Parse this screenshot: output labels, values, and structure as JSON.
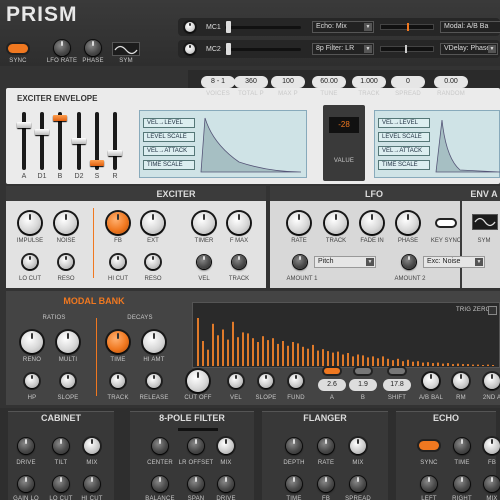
{
  "app": {
    "title": "PRISM"
  },
  "header": {
    "sync": "SYNC",
    "lfo_rate": "LFO RATE",
    "phase": "PHASE",
    "sym": "SYM",
    "mc1": "MC1",
    "mc2": "MC2",
    "sel1": "Echo: Mix",
    "sel2": "Modal: A/B Ba",
    "sel3": "8p Filter: LR",
    "sel4": "VDelay: Phase"
  },
  "params": [
    {
      "value": "8 - 1",
      "label": "VOICES"
    },
    {
      "value": "360",
      "label": "TOTAL P"
    },
    {
      "value": "100",
      "label": "MAX P"
    },
    {
      "value": "60.00",
      "label": "TUNE"
    },
    {
      "value": "1.000",
      "label": "TRACK"
    },
    {
      "value": "0",
      "label": "SPREAD"
    },
    {
      "value": "0.00",
      "label": "RANDOM"
    }
  ],
  "envelope": {
    "title": "EXCITER ENVELOPE",
    "sliders": [
      "A",
      "D1",
      "B",
      "D2",
      "S",
      "R"
    ],
    "rows": [
      "VEL→LEVEL",
      "LEVEL SCALE",
      "VEL→ATTACK",
      "TIME SCALE"
    ],
    "value": "-28",
    "value_label": "VALUE"
  },
  "exciter": {
    "title": "EXCITER",
    "row1": [
      "IMPULSE",
      "NOISE",
      "FB",
      "EXT",
      "TIMER",
      "F MAX"
    ],
    "row2": [
      "LO CUT",
      "RESO",
      "HI CUT",
      "RESO",
      "VEL",
      "TRACK"
    ]
  },
  "lfo": {
    "title": "LFO",
    "row1": [
      "RATE",
      "TRACK",
      "FADE IN",
      "PHASE",
      "KEY SYNC",
      "SYM"
    ],
    "sel1": "Pitch",
    "sel2": "Exc: Noise",
    "amt1": "AMOUNT 1",
    "amt2": "AMOUNT 2"
  },
  "env_a": {
    "title": "ENV A"
  },
  "modal": {
    "title": "MODAL BANK",
    "ratios": "RATIOS",
    "decays": "DECAYS",
    "trig_zero": "TRIG ZERO",
    "r1": [
      "RENO",
      "MULTI",
      "TIME",
      "HI AMT"
    ],
    "r2": [
      "HP",
      "SLOPE",
      "TRACK",
      "RELEASE",
      "CUT OFF",
      "VEL",
      "SLOPE",
      "FUND"
    ],
    "a": {
      "value": "2.6",
      "label": "A"
    },
    "b": {
      "value": "1.9",
      "label": "B"
    },
    "shift": {
      "value": "17.8",
      "label": "SHIFT"
    },
    "right": [
      "A/B BAL",
      "RM",
      "2ND A"
    ],
    "bars": [
      1.0,
      0.52,
      0.34,
      0.88,
      0.64,
      0.76,
      0.55,
      0.92,
      0.6,
      0.7,
      0.68,
      0.58,
      0.5,
      0.62,
      0.54,
      0.58,
      0.46,
      0.52,
      0.42,
      0.5,
      0.47,
      0.4,
      0.36,
      0.44,
      0.32,
      0.35,
      0.31,
      0.28,
      0.3,
      0.24,
      0.27,
      0.2,
      0.24,
      0.22,
      0.18,
      0.2,
      0.16,
      0.2,
      0.15,
      0.12,
      0.15,
      0.1,
      0.13,
      0.09,
      0.1,
      0.07,
      0.08,
      0.06,
      0.07,
      0.05,
      0.06,
      0.04,
      0.05,
      0.04,
      0.04,
      0.03,
      0.03,
      0.02,
      0.03,
      0.02
    ]
  },
  "bottom": {
    "cabinet": {
      "title": "CABINET",
      "r1": [
        "DRIVE",
        "TILT",
        "MIX"
      ],
      "r2": [
        "GAIN LO",
        "LO CUT",
        "HI CUT"
      ]
    },
    "filter": {
      "title": "8-POLE FILTER",
      "r1": [
        "CENTER",
        "LR OFFSET",
        "MIX"
      ],
      "r2": [
        "BALANCE",
        "SPAN",
        "DRIVE"
      ]
    },
    "flanger": {
      "title": "FLANGER",
      "r1": [
        "DEPTH",
        "RATE",
        "MIX"
      ],
      "r2": [
        "TIME",
        "FB",
        "SPREAD"
      ]
    },
    "echo": {
      "title": "ECHO",
      "r1": [
        "SYNC",
        "TIME",
        "FB"
      ],
      "r2": [
        "LEFT",
        "RIGHT",
        "MIX"
      ]
    }
  }
}
